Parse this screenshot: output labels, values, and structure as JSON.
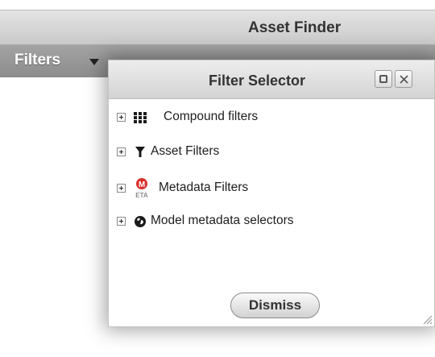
{
  "app": {
    "title": "Asset Finder"
  },
  "toolbar": {
    "filters_label": "Filters"
  },
  "dialog": {
    "title": "Filter Selector",
    "items": [
      {
        "label": "Compound filters",
        "icon": "grid-icon"
      },
      {
        "label": "Asset Filters",
        "icon": "funnel-icon"
      },
      {
        "label": "Metadata Filters",
        "icon": "metadata-icon",
        "icon_text_top": "M",
        "icon_text_bottom": "ETA"
      },
      {
        "label": "Model metadata selectors",
        "icon": "globe-icon"
      }
    ],
    "dismiss_label": "Dismiss"
  },
  "colors": {
    "metadata_red": "#d9302c",
    "header_text": "#333333",
    "filters_bar": "#999999"
  }
}
